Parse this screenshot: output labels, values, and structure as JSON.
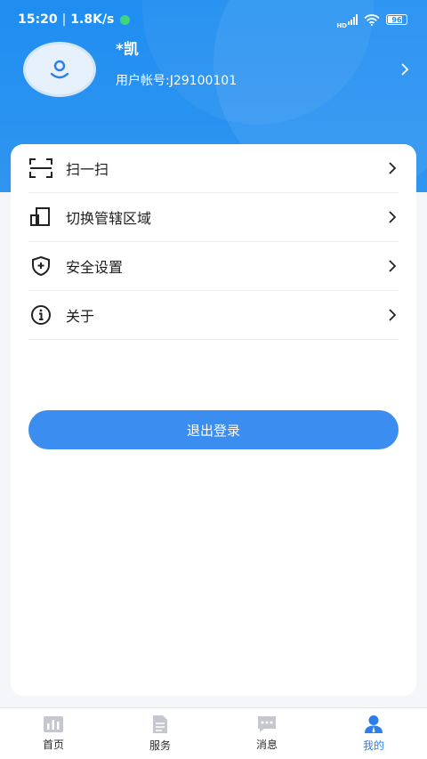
{
  "status_bar": {
    "time": "15:20",
    "network_speed": "1.8K/s",
    "network_type": "HD",
    "battery": "96"
  },
  "profile": {
    "name": "*凯",
    "account": "用户帐号:J29100101"
  },
  "menu": {
    "items": [
      {
        "label": "扫一扫",
        "icon": "scan-icon"
      },
      {
        "label": "切换管辖区域",
        "icon": "switch-area-icon"
      },
      {
        "label": "安全设置",
        "icon": "shield-icon"
      },
      {
        "label": "关于",
        "icon": "info-icon"
      }
    ]
  },
  "logout_label": "退出登录",
  "tabbar": {
    "tabs": [
      {
        "label": "首页",
        "icon": "home-chart-icon"
      },
      {
        "label": "服务",
        "icon": "document-icon"
      },
      {
        "label": "消息",
        "icon": "message-icon"
      },
      {
        "label": "我的",
        "icon": "user-icon"
      }
    ],
    "active_index": 3
  },
  "colors": {
    "header_blue": "#1f8ef1",
    "button_blue": "#3b8ef0",
    "active_tab": "#2d7fe8",
    "inactive_tab_icon": "#c4c8ce"
  }
}
